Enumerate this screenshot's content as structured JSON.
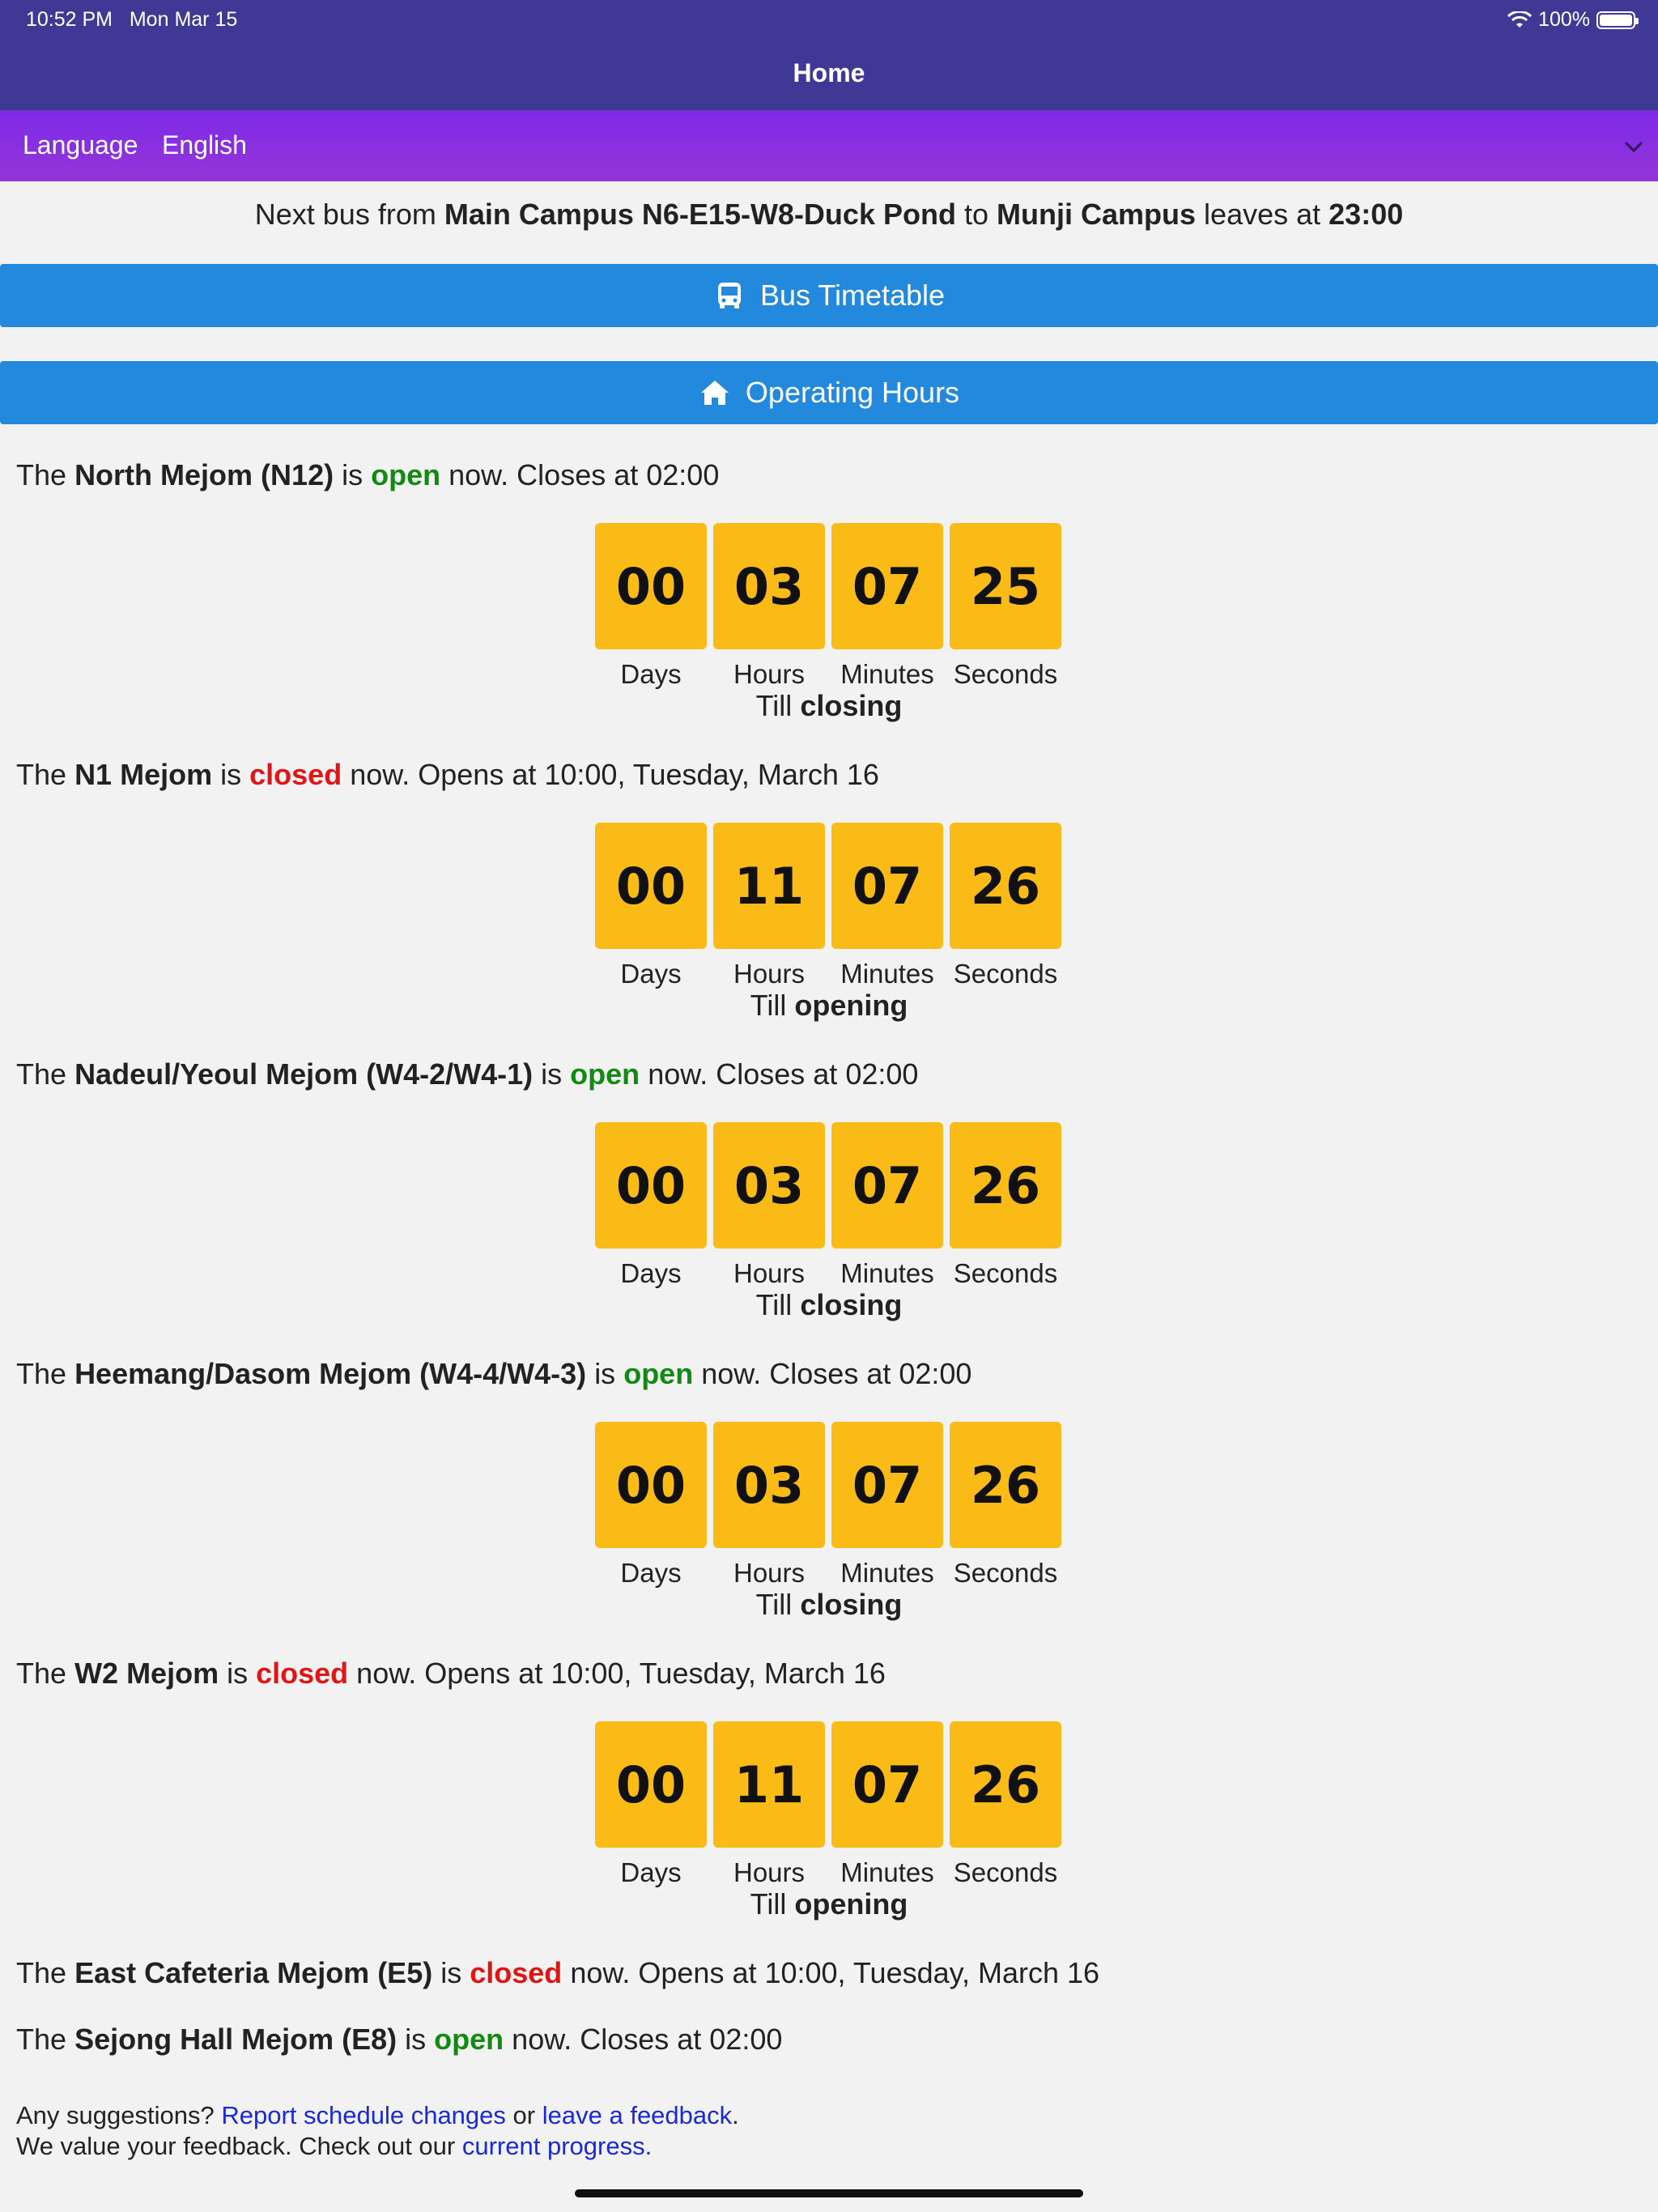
{
  "status_bar": {
    "time": "10:52 PM",
    "date": "Mon Mar 15",
    "battery": "100%"
  },
  "header": {
    "title": "Home"
  },
  "language": {
    "label": "Language",
    "value": "English"
  },
  "next_bus": {
    "prefix": "Next bus from",
    "origin": "Main Campus N6-E15-W8-Duck Pond",
    "to": "to",
    "destination": "Munji Campus",
    "leaves": "leaves at",
    "time": "23:00"
  },
  "buttons": {
    "bus_timetable": "Bus Timetable",
    "operating_hours": "Operating Hours"
  },
  "unit_labels": {
    "days": "Days",
    "hours": "Hours",
    "minutes": "Minutes",
    "seconds": "Seconds"
  },
  "till_word": "Till",
  "venues": [
    {
      "the": "The",
      "name": "North Mejom (N12)",
      "is": "is",
      "status": "open",
      "rest": "now. Closes at 02:00",
      "days": "00",
      "hours": "03",
      "minutes": "07",
      "seconds": "25",
      "till": "closing"
    },
    {
      "the": "The",
      "name": "N1 Mejom",
      "is": "is",
      "status": "closed",
      "rest": "now. Opens at 10:00, Tuesday, March 16",
      "days": "00",
      "hours": "11",
      "minutes": "07",
      "seconds": "26",
      "till": "opening"
    },
    {
      "the": "The",
      "name": "Nadeul/Yeoul Mejom (W4-2/W4-1)",
      "is": "is",
      "status": "open",
      "rest": "now. Closes at 02:00",
      "days": "00",
      "hours": "03",
      "minutes": "07",
      "seconds": "26",
      "till": "closing"
    },
    {
      "the": "The",
      "name": "Heemang/Dasom Mejom (W4-4/W4-3)",
      "is": "is",
      "status": "open",
      "rest": "now. Closes at 02:00",
      "days": "00",
      "hours": "03",
      "minutes": "07",
      "seconds": "26",
      "till": "closing"
    },
    {
      "the": "The",
      "name": "W2 Mejom",
      "is": "is",
      "status": "closed",
      "rest": "now. Opens at 10:00, Tuesday, March 16",
      "days": "00",
      "hours": "11",
      "minutes": "07",
      "seconds": "26",
      "till": "opening"
    },
    {
      "the": "The",
      "name": "East Cafeteria Mejom (E5)",
      "is": "is",
      "status": "closed",
      "rest": "now. Opens at 10:00, Tuesday, March 16"
    },
    {
      "the": "The",
      "name": "Sejong Hall Mejom (E8)",
      "is": "is",
      "status": "open",
      "rest": "now. Closes at 02:00"
    }
  ],
  "footer": {
    "line1_prefix": "Any suggestions?",
    "report_link": "Report schedule changes",
    "or": "or",
    "feedback_link": "leave a feedback",
    "period": ".",
    "line2_prefix": "We value your feedback. Check out our",
    "progress_link": "current progress."
  },
  "colors": {
    "header": "#3f3895",
    "lang_bar": "#8a30e0",
    "button": "#2389dc",
    "countdown_box": "#fbbb17",
    "open": "#118a11",
    "closed": "#e01515",
    "link": "#1a2ad4"
  }
}
